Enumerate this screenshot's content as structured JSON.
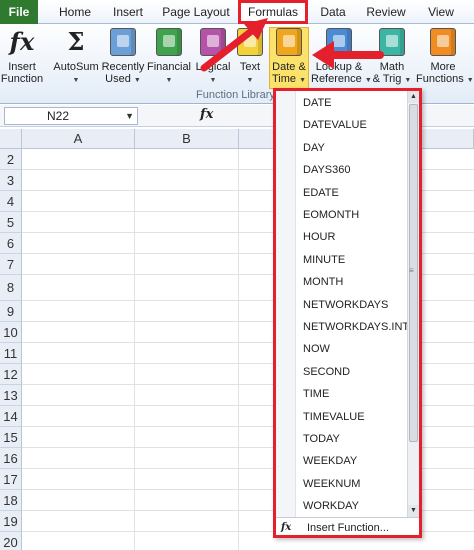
{
  "tabs": [
    "File",
    "Home",
    "Insert",
    "Page Layout",
    "Formulas",
    "Data",
    "Review",
    "View"
  ],
  "ribbon": {
    "insert_function": [
      "Insert",
      "Function"
    ],
    "autosum": "AutoSum",
    "recently_used": [
      "Recently",
      "Used"
    ],
    "financial": "Financial",
    "logical": "Logical",
    "text": "Text",
    "date_time": [
      "Date &",
      "Time"
    ],
    "lookup_reference": [
      "Lookup &",
      "Reference"
    ],
    "math_trig": [
      "Math",
      "& Trig"
    ],
    "more_functions": [
      "More",
      "Functions"
    ],
    "group_label": "Function Library",
    "colors": {
      "financial": "#3d7fc4",
      "logical": "#b453a8",
      "text": "#f2d13a",
      "date_time": "#f0a51b",
      "lookup": "#4b8bd6",
      "math": "#3db5a4",
      "more": "#f08c21"
    }
  },
  "formula_bar": {
    "name_box": "N22",
    "fx_symbol": "fx"
  },
  "grid": {
    "columns": [
      "A",
      "B"
    ],
    "rows": [
      "2",
      "3",
      "4",
      "5",
      "6",
      "7",
      "8",
      "9",
      "10",
      "11",
      "12",
      "13",
      "14",
      "15",
      "16",
      "17",
      "18",
      "19",
      "20"
    ]
  },
  "menu": {
    "items": [
      "DATE",
      "DATEVALUE",
      "DAY",
      "DAYS360",
      "EDATE",
      "EOMONTH",
      "HOUR",
      "MINUTE",
      "MONTH",
      "NETWORKDAYS",
      "NETWORKDAYS.INTL",
      "NOW",
      "SECOND",
      "TIME",
      "TIMEVALUE",
      "TODAY",
      "WEEKDAY",
      "WEEKNUM",
      "WORKDAY"
    ],
    "insert_function": "Insert Function...",
    "fx_symbol": "fx"
  },
  "highlight_color": "#e3202b"
}
